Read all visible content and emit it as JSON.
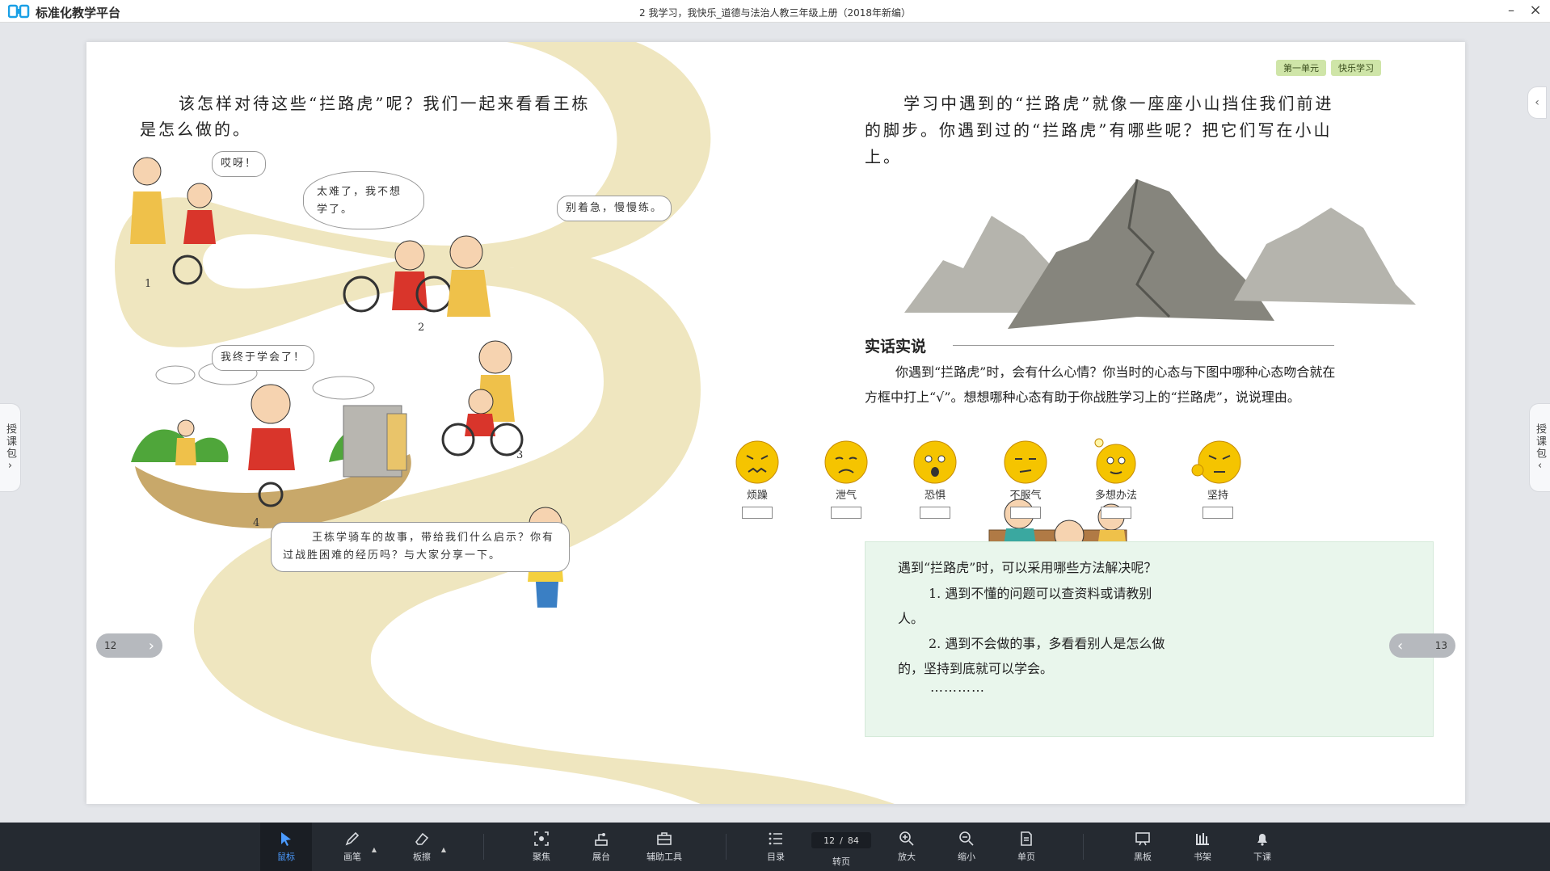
{
  "app": {
    "name": "标准化教学平台",
    "doc_title": "2 我学习，我快乐_道德与法治人教三年级上册（2018年新编）",
    "minimize_symbol": "–",
    "close_symbol": "×"
  },
  "side_tabs": {
    "left_label": "授课包",
    "left_chevron": "›",
    "right_label": "授课包",
    "right_chevron": "‹",
    "collapse_chevron": "‹"
  },
  "left_page": {
    "intro": "该怎样对待这些“拦路虎”呢？我们一起来看看王栋是怎么做的。",
    "bubbles": {
      "aiya": "哎呀！",
      "too_hard": "太难了，我不想学了。",
      "dont_worry": "别着急，慢慢练。",
      "learned": "我终于学会了！",
      "story": "王栋学骑车的故事，带给我们什么启示？你有过战胜困难的经历吗？与大家分享一下。"
    },
    "panel_numbers": [
      "1",
      "2",
      "3",
      "4"
    ],
    "page_number": "12"
  },
  "right_page": {
    "badges": [
      "第一单元",
      "快乐学习"
    ],
    "intro": "学习中遇到的“拦路虎”就像一座座小山挡住我们前进的脚步。你遇到过的“拦路虎”有哪些呢？把它们写在小山上。",
    "section_title": "实话实说",
    "section_body": "你遇到“拦路虎”时，会有什么心情？你当时的心态与下图中哪种心态吻合就在方框中打上“√”。想想哪种心态有助于你战胜学习上的“拦路虎”，说说理由。",
    "emotions": [
      "烦躁",
      "泄气",
      "恐惧",
      "不服气",
      "多想办法",
      "坚持"
    ],
    "tips": {
      "question": "遇到“拦路虎”时，可以采用哪些方法解决呢？",
      "item1": "1. 遇到不懂的问题可以查资料或请教别人。",
      "item2": "2. 遇到不会做的事，多看看别人是怎么做的，坚持到底就可以学会。",
      "ellipsis": "…………"
    },
    "page_number": "13"
  },
  "toolbar": {
    "mouse": "鼠标",
    "pen": "画笔",
    "eraser": "板擦",
    "focus": "聚焦",
    "stage": "展台",
    "assist": "辅助工具",
    "toc": "目录",
    "current_page": "12",
    "separator": "/",
    "total_pages": "84",
    "goto": "转页",
    "zoom_in": "放大",
    "zoom_out": "缩小",
    "single_page": "单页",
    "blackboard": "黑板",
    "bookshelf": "书架",
    "end_class": "下课"
  },
  "colors": {
    "accent": "#4b9bff",
    "toolbar_bg": "#252a31",
    "tips_bg": "#e9f6ec",
    "road": "#efe6bf",
    "mountain": "#8f8f8a",
    "face": "#f5c400"
  }
}
